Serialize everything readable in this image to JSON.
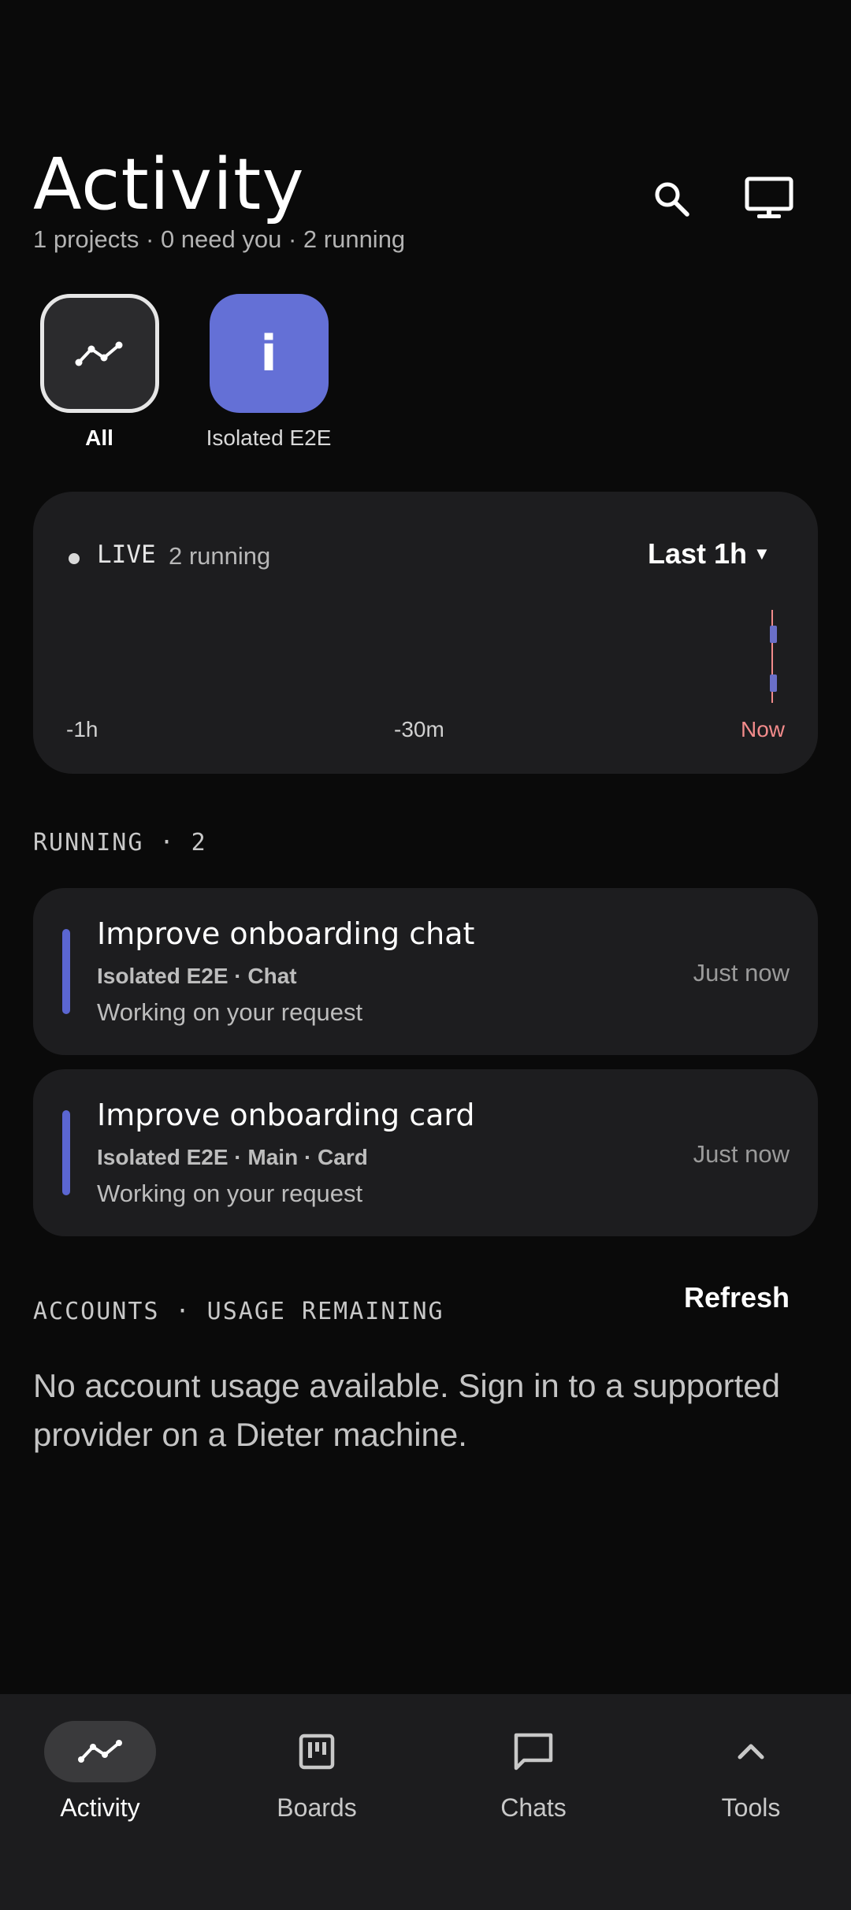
{
  "header": {
    "title": "Activity",
    "subtitle": "1 projects · 0 need you · 2 running",
    "search_icon": "search-icon",
    "desktop_icon": "desktop-icon"
  },
  "projects": [
    {
      "label": "All",
      "icon": "activity-icon",
      "selected": true
    },
    {
      "label": "Isolated E2E",
      "initial": "i",
      "color": "#6470d6",
      "selected": false
    }
  ],
  "live": {
    "live_label": "LIVE",
    "running_label": "2 running",
    "range_label": "Last 1h",
    "axis_labels": [
      "-1h",
      "-30m",
      "Now"
    ]
  },
  "running": {
    "section_label": "RUNNING · 2",
    "tasks": [
      {
        "title": "Improve onboarding chat",
        "meta": "Isolated E2E · Chat",
        "status": "Working on your request",
        "time": "Just now"
      },
      {
        "title": "Improve onboarding card",
        "meta": "Isolated E2E · Main · Card",
        "status": "Working on your request",
        "time": "Just now"
      }
    ]
  },
  "accounts": {
    "section_label": "ACCOUNTS · USAGE REMAINING",
    "refresh_label": "Refresh",
    "empty_text": "No account usage available. Sign in to a supported provider on a Dieter machine."
  },
  "nav": {
    "items": [
      {
        "label": "Activity",
        "icon": "activity-icon",
        "active": true
      },
      {
        "label": "Boards",
        "icon": "board-icon",
        "active": false
      },
      {
        "label": "Chats",
        "icon": "chat-icon",
        "active": false
      },
      {
        "label": "Tools",
        "icon": "chevron-up-icon",
        "active": false
      }
    ]
  },
  "colors": {
    "accent": "#5b66d1",
    "project_accent": "#6470d6",
    "now_marker": "#f28b8b",
    "background": "#0a0a0a",
    "card": "#1d1d1f"
  }
}
